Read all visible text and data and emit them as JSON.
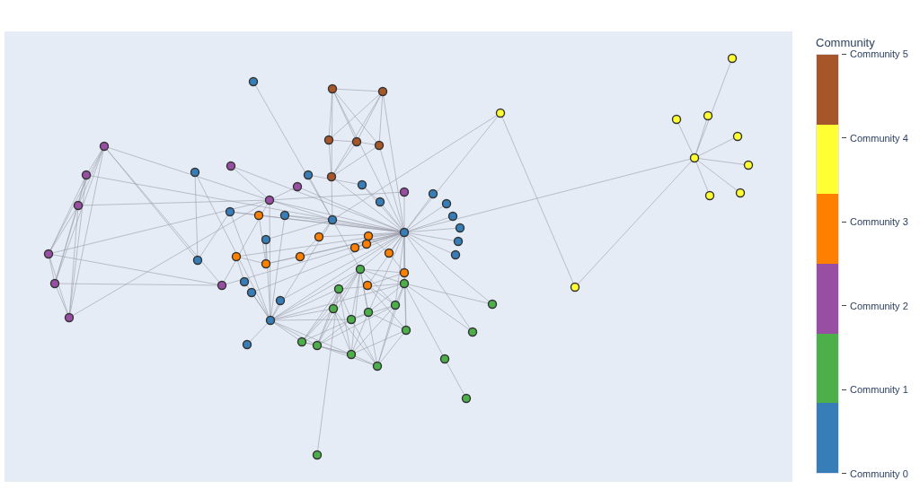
{
  "colorbar": {
    "title": "Community",
    "communities": [
      {
        "label": "Community 5",
        "color": "#a65628"
      },
      {
        "label": "Community 4",
        "color": "#ffff33"
      },
      {
        "label": "Community 3",
        "color": "#ff7f00"
      },
      {
        "label": "Community 2",
        "color": "#984ea3"
      },
      {
        "label": "Community 1",
        "color": "#4daf4a"
      },
      {
        "label": "Community 0",
        "color": "#377eb8"
      }
    ]
  }
}
